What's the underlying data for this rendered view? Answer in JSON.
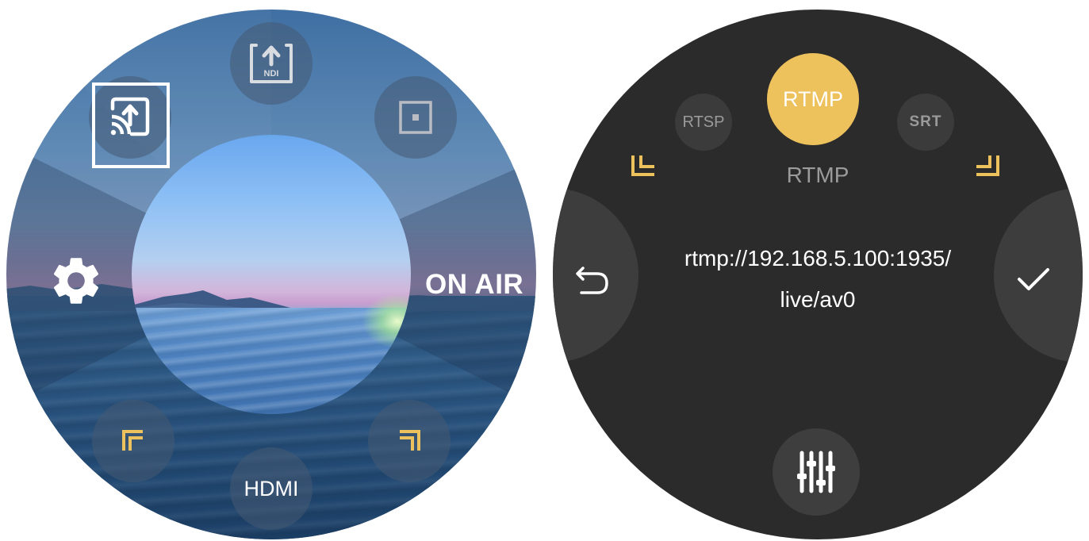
{
  "left_dial": {
    "center_button": "ON AIR",
    "bottom_source": "HDMI",
    "icons": {
      "top": "ndi-upload-icon",
      "top_left": "cast-upload-icon",
      "top_right": "record-square-icon",
      "left": "gear-icon",
      "bottom_left": "corner-bracket-icon",
      "bottom_right": "corner-bracket-icon"
    },
    "ndi_badge": "NDI",
    "accent_color": "#edc15c"
  },
  "right_dial": {
    "protocols": [
      "RTSP",
      "RTMP",
      "SRT"
    ],
    "selected_protocol": "RTMP",
    "protocol_title": "RTMP",
    "url_line1": "rtmp://192.168.5.100:1935/",
    "url_line2": "live/av0",
    "icons": {
      "left": "back-arrow-icon",
      "right": "checkmark-icon",
      "bottom": "sliders-icon",
      "top_left": "corner-bracket-icon",
      "top_right": "corner-bracket-icon"
    },
    "accent_color": "#edc15c"
  }
}
